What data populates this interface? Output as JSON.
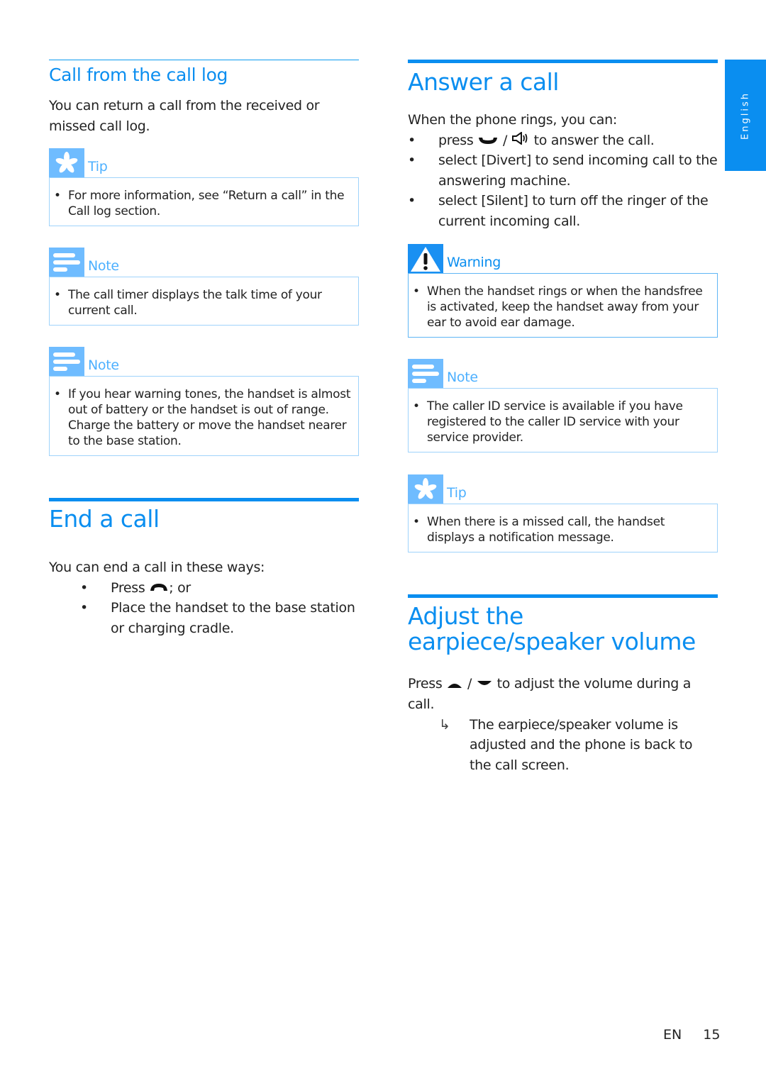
{
  "side_tab": {
    "language": "English"
  },
  "left_column": {
    "call_from_log": {
      "heading": "Call from the call log",
      "intro": "You can return a call from the received or missed call log.",
      "tip": {
        "label": "Tip",
        "items": [
          "For more information, see “Return a call” in the Call log section."
        ]
      },
      "note1": {
        "label": "Note",
        "items": [
          "The call timer displays the talk time of your current call."
        ]
      },
      "note2": {
        "label": "Note",
        "items": [
          "If you hear warning tones, the handset is almost out of battery or the handset is out of range. Charge the battery or move the handset nearer to the base station."
        ]
      }
    },
    "end_call": {
      "heading": "End a call",
      "intro": "You can end a call in these ways:",
      "bullets": [
        {
          "before": "Press",
          "icon": "end-call-icon",
          "after": "; or"
        },
        {
          "text": "Place the handset to the base station or charging cradle."
        }
      ]
    }
  },
  "right_column": {
    "answer_call": {
      "heading": "Answer a call",
      "intro": "When the phone rings, you can:",
      "bullets": [
        {
          "before": "press",
          "icons": [
            "talk-icon",
            "speaker-icon"
          ],
          "separator": "/",
          "after": "to answer the call."
        },
        {
          "text": "select [Divert] to send incoming call to the answering machine.",
          "prefix": "select ",
          "keyword": "[Divert]",
          "suffix": " to send incoming call to the answering machine."
        },
        {
          "text": "select [Silent] to turn off the ringer of the current incoming call.",
          "prefix": "select ",
          "keyword": "[Silent]",
          "suffix": " to turn off the ringer of the current incoming call."
        }
      ],
      "warning": {
        "label": "Warning",
        "items": [
          "When the handset rings or when the handsfree is activated, keep the handset away from your ear to avoid ear damage."
        ]
      },
      "note": {
        "label": "Note",
        "items": [
          "The caller ID service is available if you have registered to the caller ID service with your service provider."
        ]
      },
      "tip": {
        "label": "Tip",
        "items": [
          "When there is a missed call, the handset displays a notification message."
        ]
      }
    },
    "adjust_volume": {
      "heading": "Adjust the earpiece/speaker volume",
      "instruction_before": "Press",
      "icons": [
        "volume-up-icon",
        "volume-down-icon"
      ],
      "separator": "/",
      "instruction_after": "to adjust the volume during a call.",
      "result_arrow": "↳",
      "result": "The earpiece/speaker volume is adjusted and the phone is back to the call screen."
    }
  },
  "footer": {
    "language_code": "EN",
    "page_number": "15"
  },
  "bullet_char": "•",
  "colors": {
    "accent": "#0a8ef0",
    "box_border": "#9fd3fb",
    "icon_bg": "#6fbcff"
  }
}
